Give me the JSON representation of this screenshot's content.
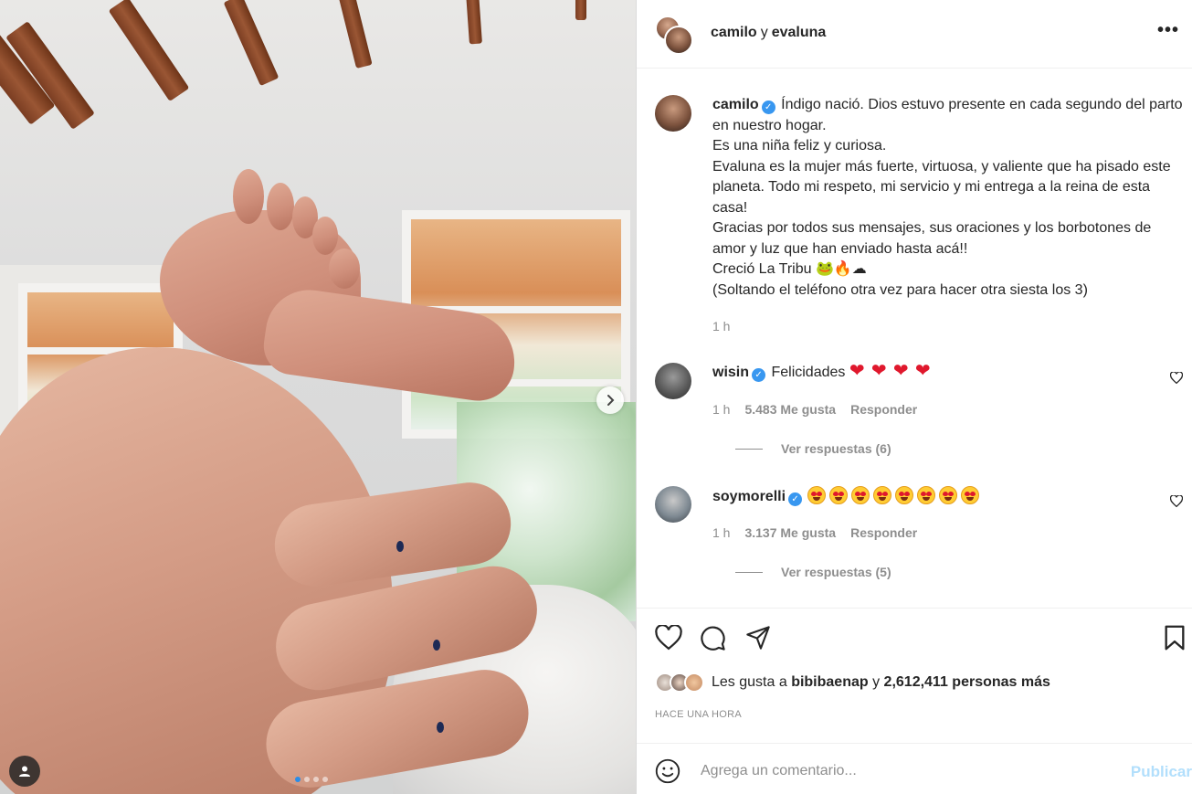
{
  "header": {
    "user1": "camilo",
    "joiner": "y",
    "user2": "evaluna",
    "more": "•••"
  },
  "caption": {
    "username": "camilo",
    "text": "Índigo nació. Dios estuvo presente en cada segundo del parto en nuestro hogar.\nEs una niña feliz y curiosa.\nEvaluna es la mujer más fuerte, virtuosa, y valiente que ha pisado este planeta. Todo mi respeto, mi servicio y mi entrega a la reina de esta casa!\nGracias por todos sus mensajes, sus oraciones y los borbotones de amor y luz que han enviado hasta acá!!\nCreció La Tribu 🐸🔥☁\n(Soltando el teléfono otra vez para hacer otra siesta los 3)",
    "time": "1 h"
  },
  "comments": [
    {
      "username": "wisin",
      "emoji": "heart",
      "emoji_count": 4,
      "text": "Felicidades",
      "time": "1 h",
      "likes": "5.483 Me gusta",
      "reply": "Responder",
      "view_replies": "Ver respuestas (6)"
    },
    {
      "username": "soymorelli",
      "emoji": "heart-eyes",
      "emoji_count": 8,
      "text": "",
      "time": "1 h",
      "likes": "3.137 Me gusta",
      "reply": "Responder",
      "view_replies": "Ver respuestas (5)"
    }
  ],
  "likes": {
    "prefix": "Les gusta a",
    "user": "bibibaenap",
    "joiner": "y",
    "count": "2,612,411 personas más"
  },
  "timestamp": "HACE UNA HORA",
  "comment_box": {
    "placeholder": "Agrega un comentario...",
    "publish": "Publicar"
  },
  "carousel": {
    "total_slides": 4,
    "active_index": 0
  },
  "colors": {
    "verified": "#3897f0",
    "publish_disabled": "#b2dffc",
    "muted": "#8e8e8e"
  }
}
